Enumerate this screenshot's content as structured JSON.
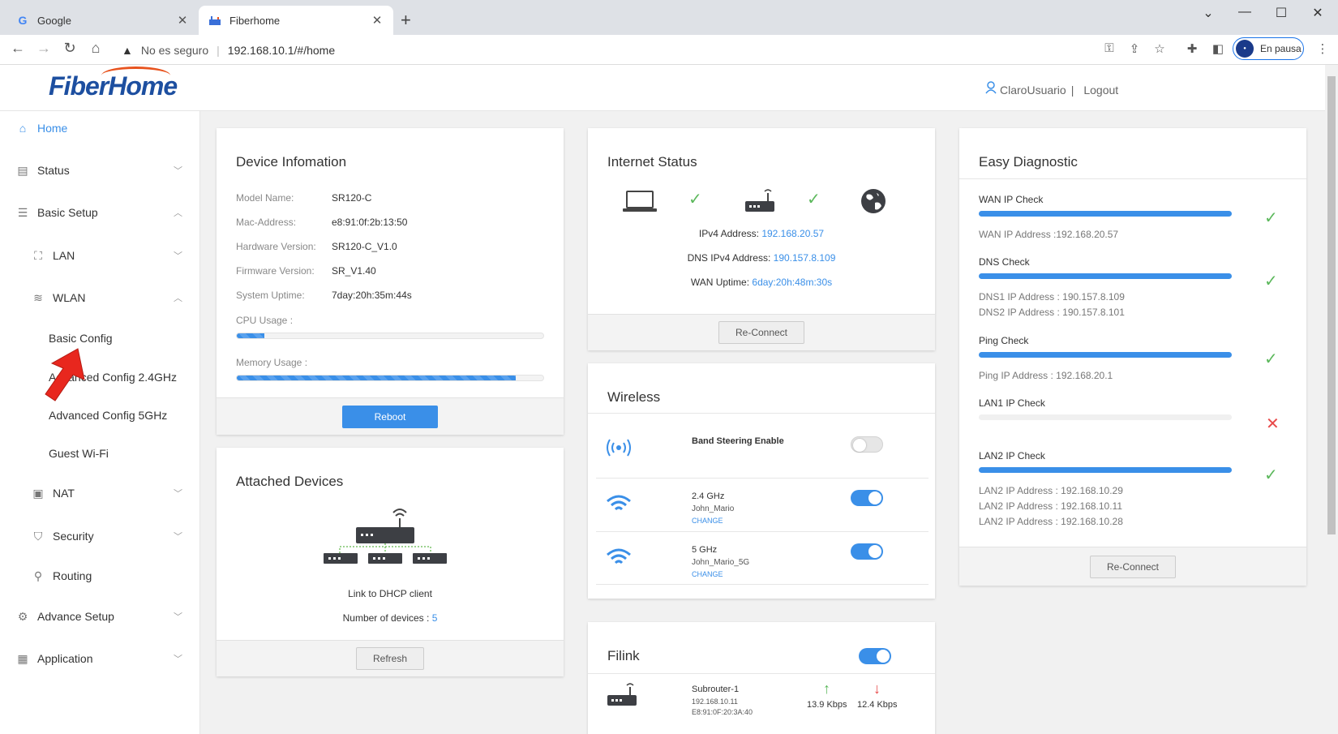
{
  "browser": {
    "tabs": [
      {
        "title": "Google",
        "favicon": "google-g-icon"
      },
      {
        "title": "Fiberhome",
        "favicon": "fiberhome-icon"
      }
    ],
    "new_tab": "+",
    "window_controls": [
      "⌄",
      "—",
      "☐",
      "✕"
    ],
    "security_text": "No es seguro",
    "url": "192.168.10.1/#/home",
    "profile_label": "En pausa"
  },
  "header": {
    "logo_text": "FiberHome",
    "username": "ClaroUsuario",
    "separator": "|",
    "logout": "Logout"
  },
  "sidebar": {
    "items": [
      {
        "label": "Home",
        "icon": "home-icon"
      },
      {
        "label": "Status",
        "icon": "status-icon"
      },
      {
        "label": "Basic Setup",
        "icon": "sliders-icon"
      },
      {
        "label": "LAN",
        "icon": "lan-icon"
      },
      {
        "label": "WLAN",
        "icon": "wifi-icon"
      },
      {
        "label": "Basic Config"
      },
      {
        "label": "Advanced Config 2.4GHz"
      },
      {
        "label": "Advanced Config 5GHz"
      },
      {
        "label": "Guest Wi-Fi"
      },
      {
        "label": "NAT",
        "icon": "nat-icon"
      },
      {
        "label": "Security",
        "icon": "shield-icon"
      },
      {
        "label": "Routing",
        "icon": "routing-icon"
      },
      {
        "label": "Advance Setup",
        "icon": "gear-icon"
      },
      {
        "label": "Application",
        "icon": "apps-icon"
      }
    ]
  },
  "device_info": {
    "title": "Device Infomation",
    "fields": [
      {
        "key": "Model Name:",
        "value": "SR120-C"
      },
      {
        "key": "Mac-Address:",
        "value": "e8:91:0f:2b:13:50"
      },
      {
        "key": "Hardware Version:",
        "value": "SR120-C_V1.0"
      },
      {
        "key": "Firmware Version:",
        "value": "SR_V1.40"
      },
      {
        "key": "System Uptime:",
        "value": "7day:20h:35m:44s"
      }
    ],
    "cpu_label": "CPU Usage :",
    "cpu_percent": 9,
    "mem_label": "Memory Usage :",
    "mem_percent": 91,
    "reboot": "Reboot"
  },
  "attached": {
    "title": "Attached Devices",
    "link_text": "Link to DHCP client",
    "count_label": "Number of devices :",
    "count": "5",
    "refresh": "Refresh"
  },
  "internet": {
    "title": "Internet Status",
    "ipv4_label": "IPv4 Address:",
    "ipv4": "192.168.20.57",
    "dns_label": "DNS IPv4 Address:",
    "dns": "190.157.8.109",
    "uptime_label": "WAN Uptime:",
    "uptime": "6day:20h:48m:30s",
    "reconnect": "Re-Connect"
  },
  "wireless": {
    "title": "Wireless",
    "band_steering": "Band Steering Enable",
    "band_steering_on": false,
    "bands": [
      {
        "name": "2.4 GHz",
        "ssid": "John_Mario",
        "change": "CHANGE",
        "on": true
      },
      {
        "name": "5 GHz",
        "ssid": "John_Mario_5G",
        "change": "CHANGE",
        "on": true
      }
    ]
  },
  "filink": {
    "title": "Filink",
    "on": true,
    "device_name": "Subrouter-1",
    "device_ip": "192.168.10.11",
    "device_mac": "E8:91:0F:20:3A:40",
    "up": "13.9 Kbps",
    "down": "12.4 Kbps"
  },
  "diagnostic": {
    "title": "Easy Diagnostic",
    "checks": [
      {
        "label": "WAN IP Check",
        "ok": true,
        "progress": 100,
        "info": [
          "WAN IP Address :192.168.20.57"
        ]
      },
      {
        "label": "DNS Check",
        "ok": true,
        "progress": 100,
        "info": [
          "DNS1 IP Address : 190.157.8.109",
          "DNS2 IP Address : 190.157.8.101"
        ]
      },
      {
        "label": "Ping Check",
        "ok": true,
        "progress": 100,
        "info": [
          "Ping IP Address : 192.168.20.1"
        ]
      },
      {
        "label": "LAN1 IP Check",
        "ok": false,
        "progress": 0,
        "info": []
      },
      {
        "label": "LAN2 IP Check",
        "ok": true,
        "progress": 100,
        "info": [
          "LAN2 IP Address : 192.168.10.29",
          "LAN2 IP Address : 192.168.10.11",
          "LAN2 IP Address : 192.168.10.28"
        ]
      }
    ],
    "reconnect": "Re-Connect"
  },
  "colors": {
    "accent": "#3a8fe8",
    "ok": "#5cb85c",
    "error": "#e84a4a",
    "logo": "#1d4fa0",
    "logo_swoosh": "#e8531e"
  }
}
